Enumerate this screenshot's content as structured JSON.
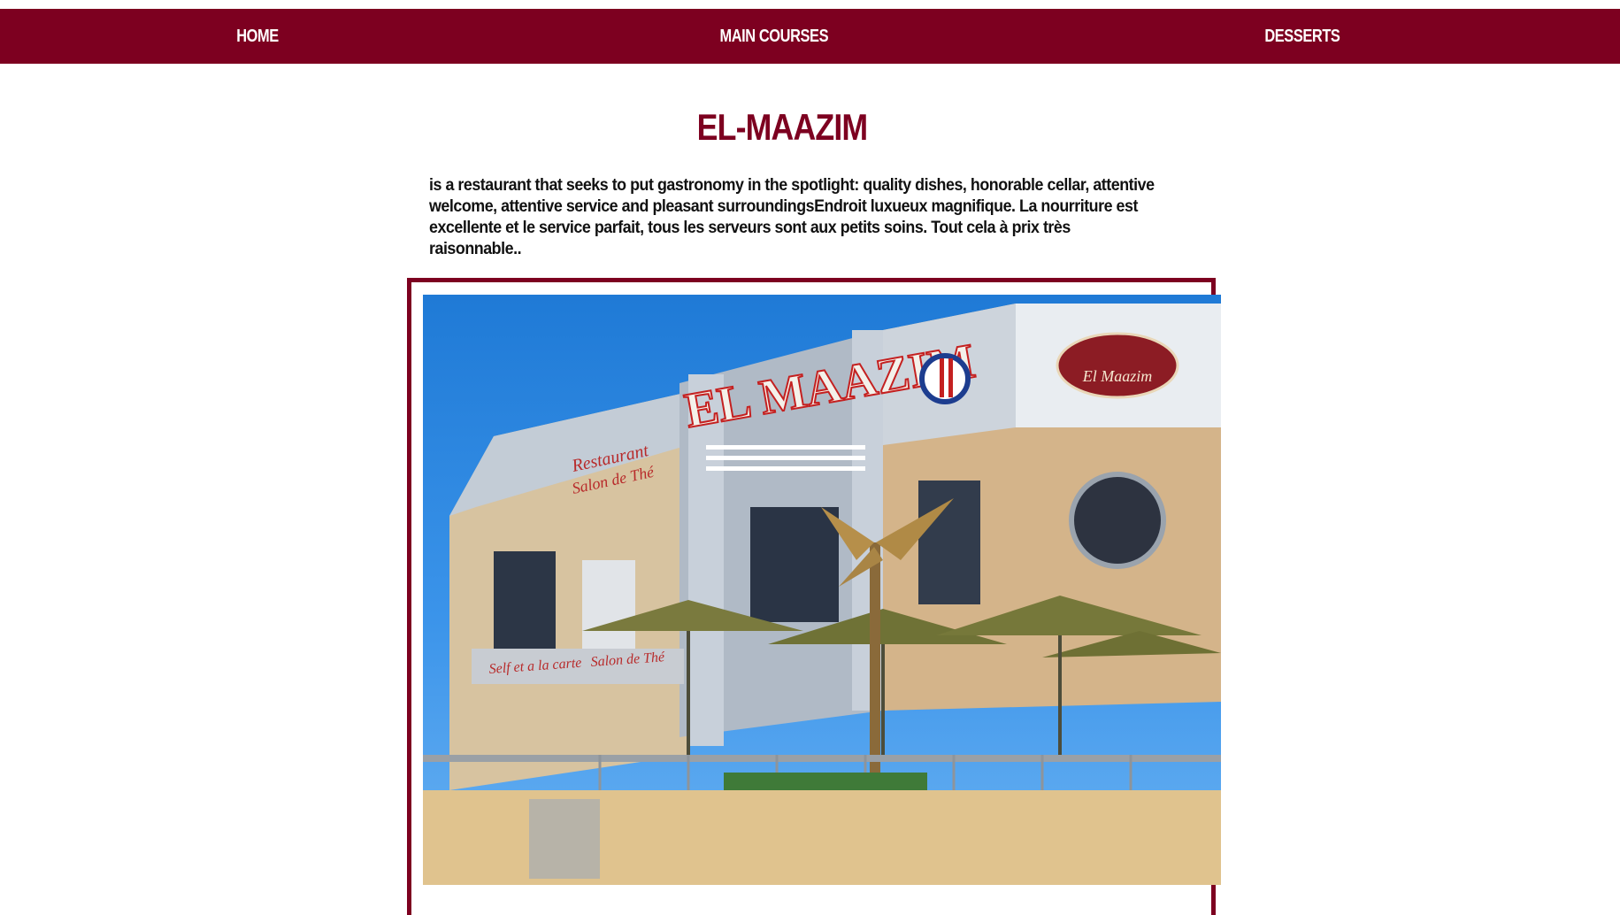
{
  "nav": {
    "home": "HOME",
    "main_courses": "MAIN COURSES",
    "desserts": "DESSERTS"
  },
  "title": "EL-MAAZIM",
  "description": "is a restaurant that seeks to put gastronomy in the spotlight: quality dishes, honorable cellar, attentive welcome, attentive service and pleasant surroundingsEndroit luxueux magnifique. La nourriture est excellente et le service parfait, tous les serveurs sont aux petits soins. Tout cela à prix très raisonnable..",
  "photo": {
    "sign_main": "EL MAAZIM",
    "sign_restaurant": "Restaurant",
    "sign_salon": "Salon de Thé",
    "sign_logo": "El Maazim",
    "sign_self": "Self et a la carte",
    "sign_salon_lower": "Salon de Thé"
  },
  "colors": {
    "brand": "#7d0020",
    "nav_text": "#ffffff",
    "body_text": "#111111"
  }
}
